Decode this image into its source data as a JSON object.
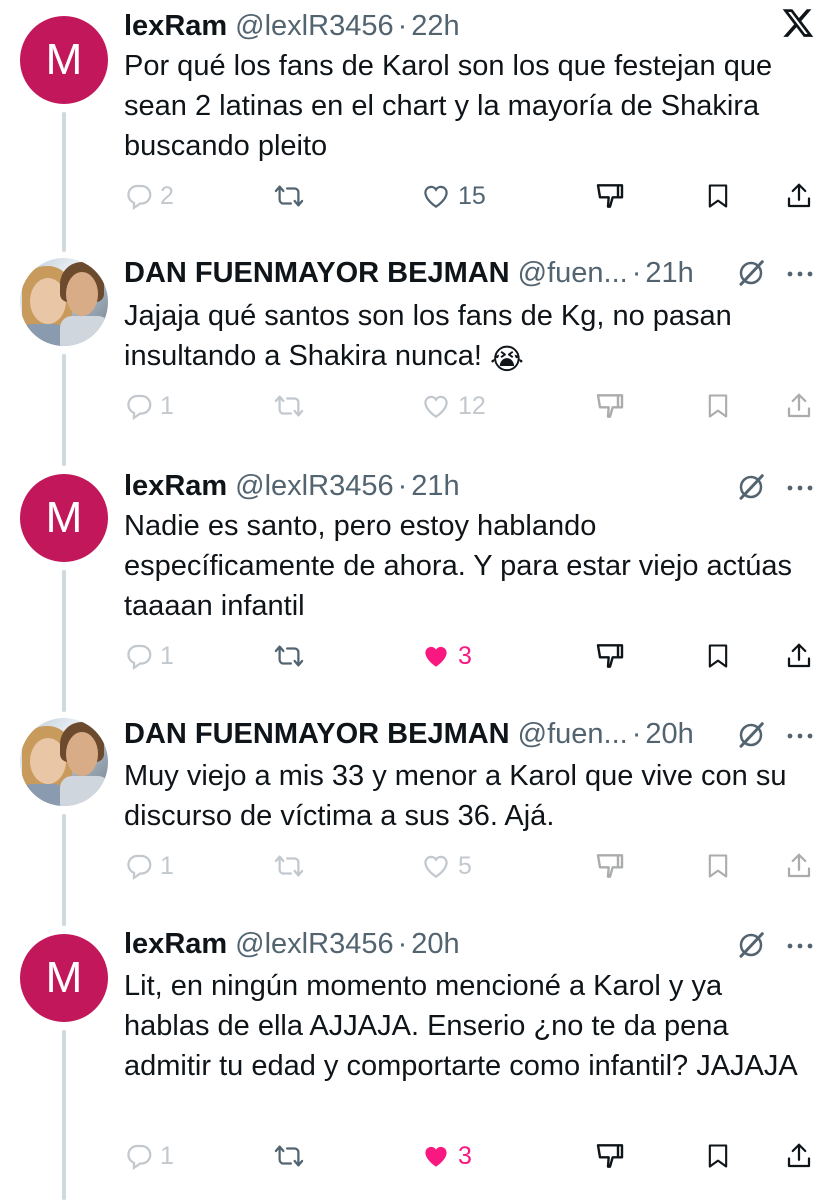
{
  "tweets": [
    {
      "name": "lexRam",
      "handle": "@lexlR3456",
      "time": "22h",
      "avatar_letter": "M",
      "text": "Por qué los fans de Karol son los que festejan que sean 2 latinas en el chart y la mayoría de Shakira buscando pleito",
      "replies": "2",
      "likes": "15",
      "liked": false
    },
    {
      "name": "DAN FUENMAYOR BEJMAN",
      "handle": "@fuen...",
      "time": "21h",
      "text": "Jajaja qué santos son los fans de Kg, no pasan insultando a Shakira nunca!",
      "emoji": "😭",
      "replies": "1",
      "likes": "12",
      "liked": false
    },
    {
      "name": "lexRam",
      "handle": "@lexlR3456",
      "time": "21h",
      "avatar_letter": "M",
      "text": "Nadie es santo, pero estoy hablando específicamente de ahora. Y para estar viejo actúas taaaan infantil",
      "replies": "1",
      "likes": "3",
      "liked": true
    },
    {
      "name": "DAN FUENMAYOR BEJMAN",
      "handle": "@fuen...",
      "time": "20h",
      "text": "Muy viejo a mis 33 y menor a Karol que vive con su discurso de víctima a sus 36. Ajá.",
      "replies": "1",
      "likes": "5",
      "liked": false
    },
    {
      "name": "lexRam",
      "handle": "@lexlR3456",
      "time": "20h",
      "avatar_letter": "M",
      "text": "Lit, en ningún momento mencioné a Karol y ya hablas de ella AJJAJA. Enserio ¿no te da pena admitir tu edad y comportarte como infantil? JAJAJA",
      "replies": "1",
      "likes": "3",
      "liked": true
    }
  ],
  "icons": {
    "x_logo": "x-logo-icon",
    "reply": "reply-icon",
    "retweet": "retweet-icon",
    "like": "heart-icon",
    "dislike": "downvote-icon",
    "bookmark": "bookmark-icon",
    "share": "share-icon",
    "grok": "grok-icon",
    "more": "more-icon"
  },
  "colors": {
    "avatar_m": "#c2185b",
    "liked": "#f91880",
    "secondary": "#536471"
  }
}
